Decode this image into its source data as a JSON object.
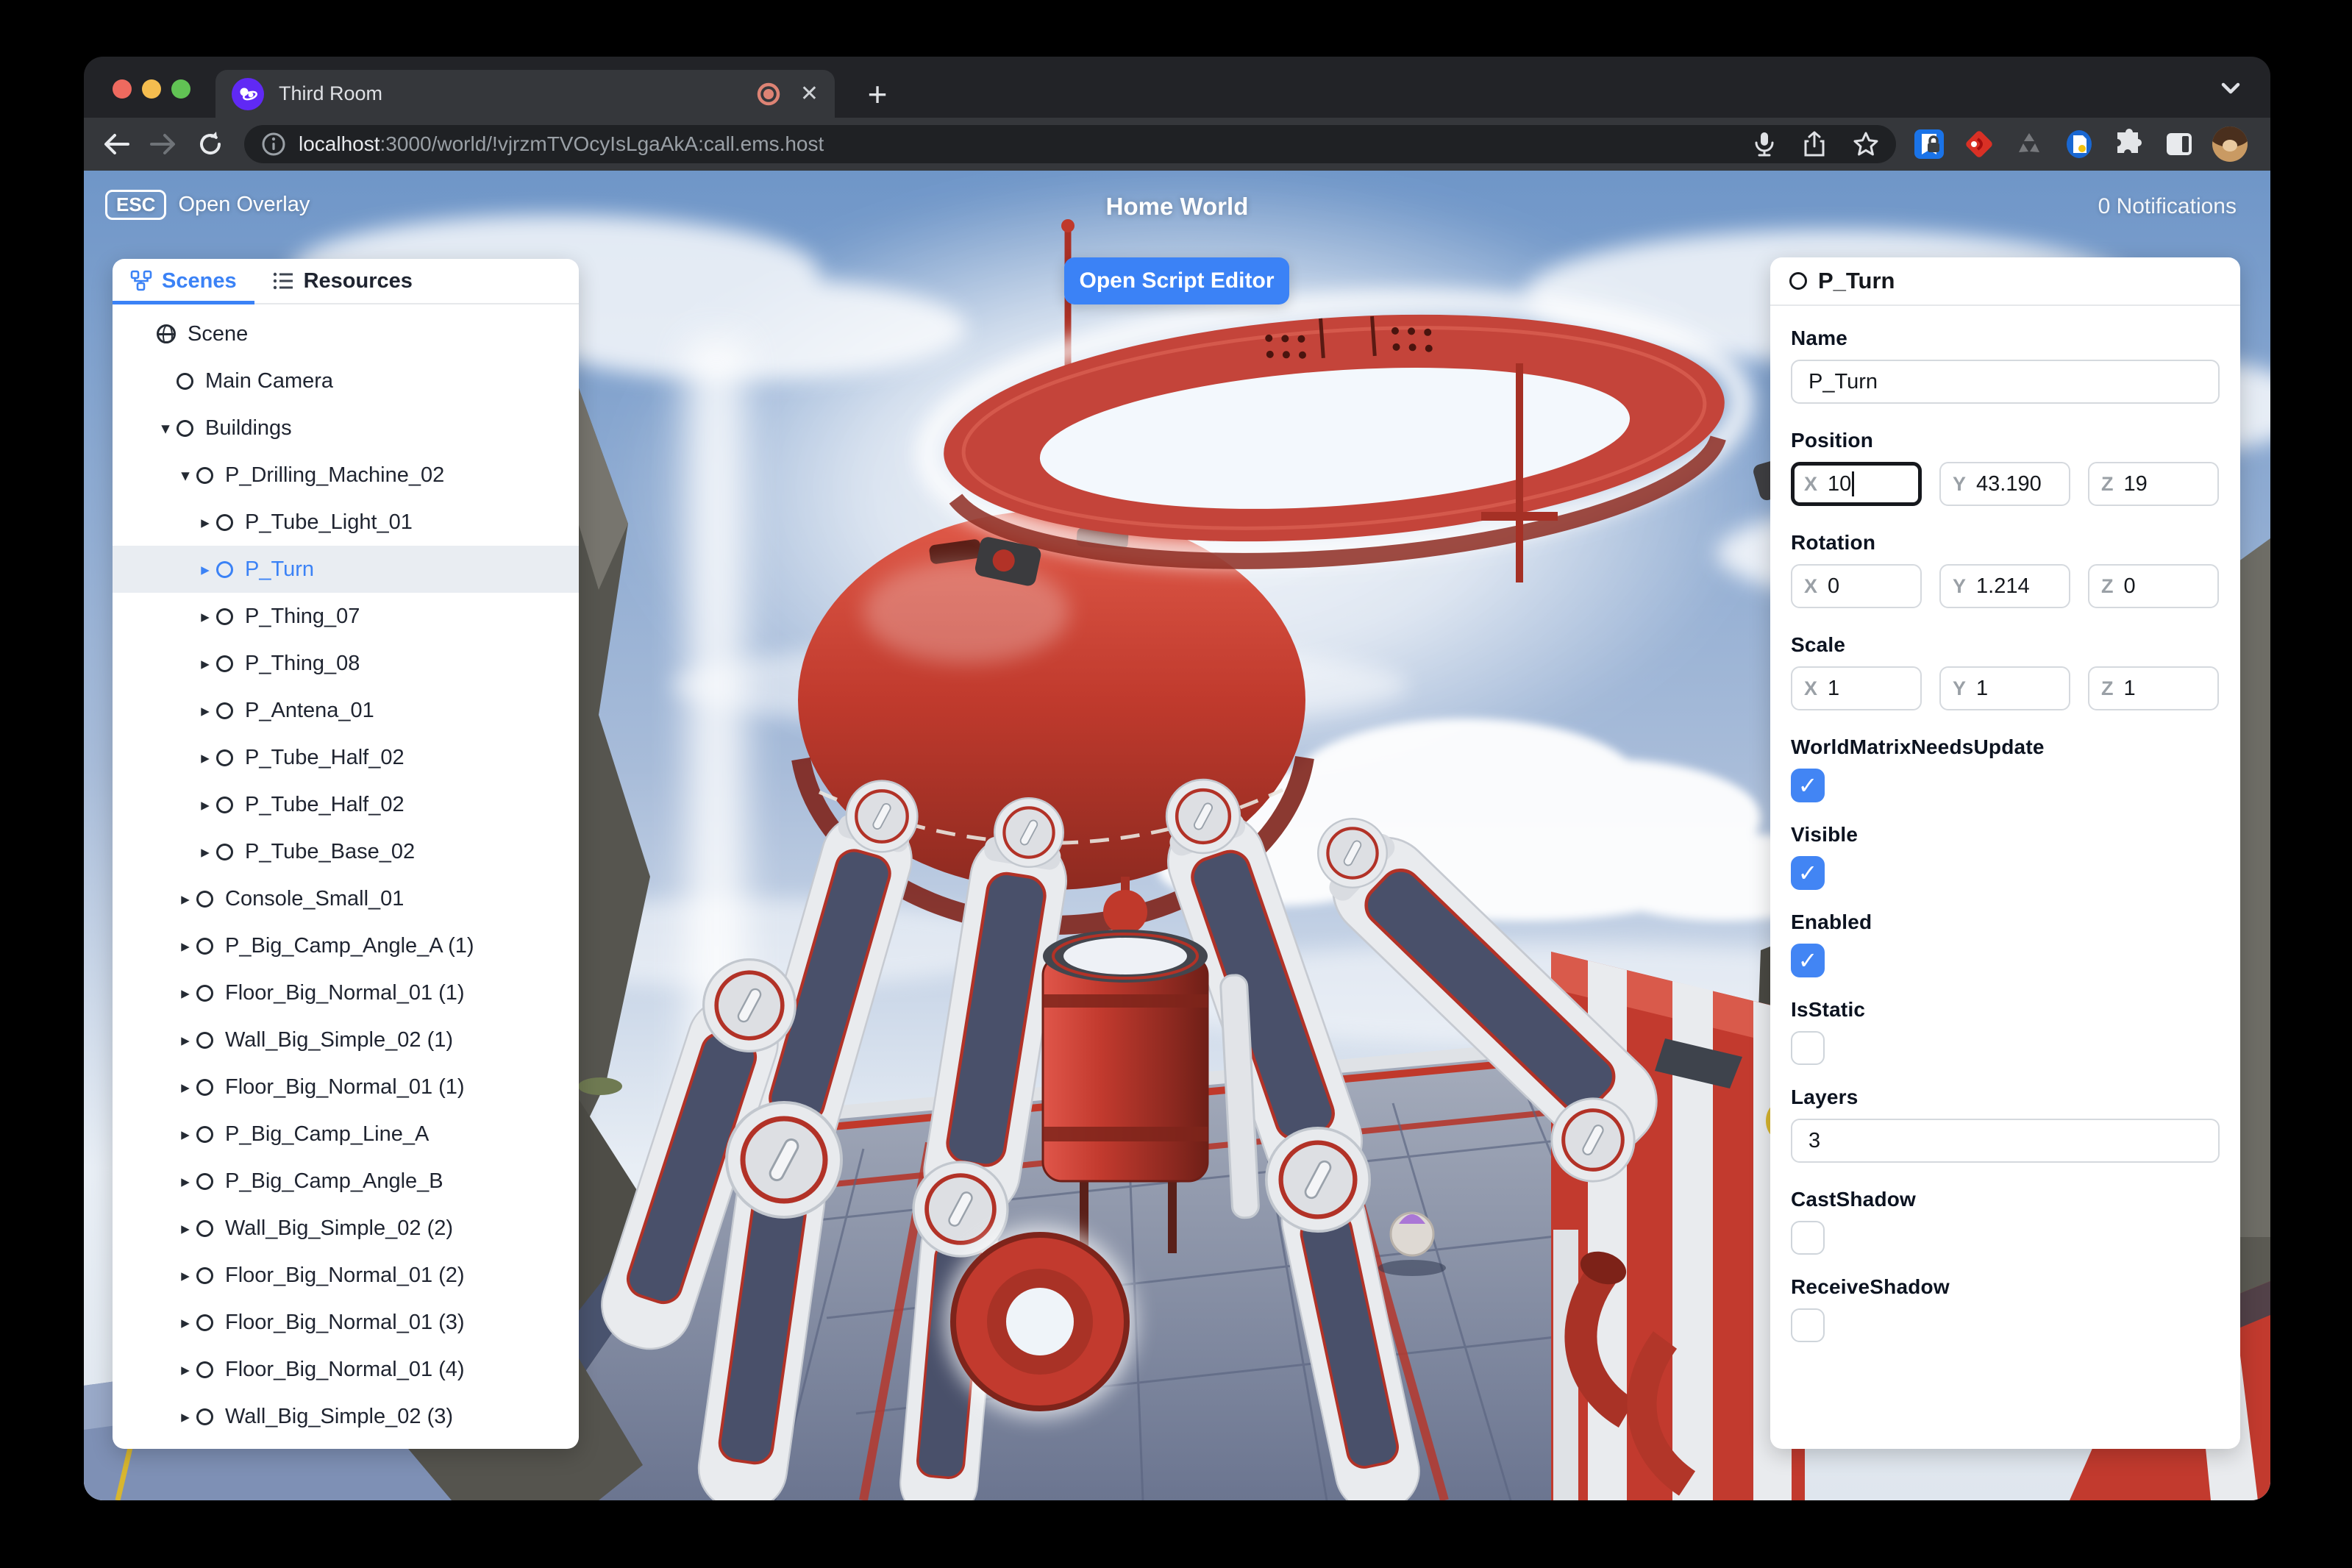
{
  "browser": {
    "tab_title": "Third Room",
    "new_tab_label": "+",
    "url_host": "localhost",
    "url_rest": ":3000/world/!vjrzmTVOcyIsLgaAkA:call.ems.host"
  },
  "header_overlay": {
    "esc_key": "ESC",
    "esc_action": "Open Overlay",
    "world_title": "Home World",
    "notifications": "0 Notifications",
    "script_editor_button": "Open Script Editor"
  },
  "scene_panel": {
    "tabs": [
      {
        "label": "Scenes",
        "active": true
      },
      {
        "label": "Resources",
        "active": false
      }
    ],
    "items": [
      {
        "label": "Scene",
        "icon": "globe",
        "depth": 0,
        "caret": "",
        "selected": false
      },
      {
        "label": "Main Camera",
        "icon": "circle",
        "depth": 1,
        "caret": "",
        "selected": false
      },
      {
        "label": "Buildings",
        "icon": "circle",
        "depth": 1,
        "caret": "down",
        "selected": false
      },
      {
        "label": "P_Drilling_Machine_02",
        "icon": "circle",
        "depth": 2,
        "caret": "down",
        "selected": false
      },
      {
        "label": "P_Tube_Light_01",
        "icon": "circle",
        "depth": 3,
        "caret": "right",
        "selected": false
      },
      {
        "label": "P_Turn",
        "icon": "circle",
        "depth": 3,
        "caret": "right",
        "selected": true
      },
      {
        "label": "P_Thing_07",
        "icon": "circle",
        "depth": 3,
        "caret": "right",
        "selected": false
      },
      {
        "label": "P_Thing_08",
        "icon": "circle",
        "depth": 3,
        "caret": "right",
        "selected": false
      },
      {
        "label": "P_Antena_01",
        "icon": "circle",
        "depth": 3,
        "caret": "right",
        "selected": false
      },
      {
        "label": "P_Tube_Half_02",
        "icon": "circle",
        "depth": 3,
        "caret": "right",
        "selected": false
      },
      {
        "label": "P_Tube_Half_02",
        "icon": "circle",
        "depth": 3,
        "caret": "right",
        "selected": false
      },
      {
        "label": "P_Tube_Base_02",
        "icon": "circle",
        "depth": 3,
        "caret": "right",
        "selected": false
      },
      {
        "label": "Console_Small_01",
        "icon": "circle",
        "depth": 2,
        "caret": "right",
        "selected": false
      },
      {
        "label": "P_Big_Camp_Angle_A (1)",
        "icon": "circle",
        "depth": 2,
        "caret": "right",
        "selected": false
      },
      {
        "label": "Floor_Big_Normal_01 (1)",
        "icon": "circle",
        "depth": 2,
        "caret": "right",
        "selected": false
      },
      {
        "label": "Wall_Big_Simple_02 (1)",
        "icon": "circle",
        "depth": 2,
        "caret": "right",
        "selected": false
      },
      {
        "label": "Floor_Big_Normal_01 (1)",
        "icon": "circle",
        "depth": 2,
        "caret": "right",
        "selected": false
      },
      {
        "label": "P_Big_Camp_Line_A",
        "icon": "circle",
        "depth": 2,
        "caret": "right",
        "selected": false
      },
      {
        "label": "P_Big_Camp_Angle_B",
        "icon": "circle",
        "depth": 2,
        "caret": "right",
        "selected": false
      },
      {
        "label": "Wall_Big_Simple_02 (2)",
        "icon": "circle",
        "depth": 2,
        "caret": "right",
        "selected": false
      },
      {
        "label": "Floor_Big_Normal_01 (2)",
        "icon": "circle",
        "depth": 2,
        "caret": "right",
        "selected": false
      },
      {
        "label": "Floor_Big_Normal_01 (3)",
        "icon": "circle",
        "depth": 2,
        "caret": "right",
        "selected": false
      },
      {
        "label": "Floor_Big_Normal_01 (4)",
        "icon": "circle",
        "depth": 2,
        "caret": "right",
        "selected": false
      },
      {
        "label": "Wall_Big_Simple_02 (3)",
        "icon": "circle",
        "depth": 2,
        "caret": "right",
        "selected": false
      }
    ]
  },
  "properties_panel": {
    "header": "P_Turn",
    "axis_prefixes": [
      "X",
      "Y",
      "Z"
    ],
    "sections": [
      {
        "type": "text",
        "label": "Name",
        "value": "P_Turn"
      },
      {
        "type": "vector3",
        "label": "Position",
        "values": [
          "10",
          "43.190",
          "19"
        ],
        "focused": 0
      },
      {
        "type": "vector3",
        "label": "Rotation",
        "values": [
          "0",
          "1.214",
          "0"
        ],
        "focused": -1
      },
      {
        "type": "vector3",
        "label": "Scale",
        "values": [
          "1",
          "1",
          "1"
        ],
        "focused": -1
      },
      {
        "type": "checkbox",
        "label": "WorldMatrixNeedsUpdate",
        "checked": true
      },
      {
        "type": "checkbox",
        "label": "Visible",
        "checked": true
      },
      {
        "type": "checkbox",
        "label": "Enabled",
        "checked": true
      },
      {
        "type": "checkbox",
        "label": "IsStatic",
        "checked": false
      },
      {
        "type": "text",
        "label": "Layers",
        "value": "3"
      },
      {
        "type": "checkbox",
        "label": "CastShadow",
        "checked": false
      },
      {
        "type": "checkbox",
        "label": "ReceiveShadow",
        "checked": false
      }
    ]
  },
  "colors": {
    "accent": "#3b82f6",
    "checkbox_checked": "#4285f4",
    "machine_red": "#c23a2e",
    "selection_glow": "#ffffff"
  }
}
